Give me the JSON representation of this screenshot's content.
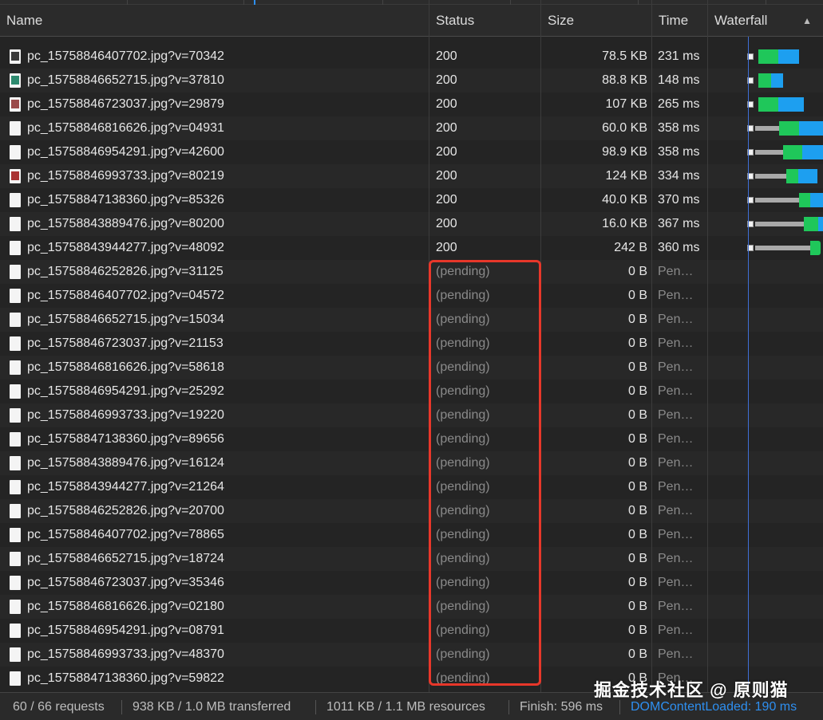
{
  "columns": {
    "name": "Name",
    "status": "Status",
    "size": "Size",
    "time": "Time",
    "waterfall": "Waterfall"
  },
  "rows": [
    {
      "name": "pc_15758846407702.jpg?v=70342",
      "status": "200",
      "size": "78.5 KB",
      "time": "231 ms",
      "icon": "image-file-icon"
    },
    {
      "name": "pc_15758846652715.jpg?v=37810",
      "status": "200",
      "size": "88.8 KB",
      "time": "148 ms",
      "icon": "image-file-icon"
    },
    {
      "name": "pc_15758846723037.jpg?v=29879",
      "status": "200",
      "size": "107 KB",
      "time": "265 ms",
      "icon": "image-file-icon"
    },
    {
      "name": "pc_15758846816626.jpg?v=04931",
      "status": "200",
      "size": "60.0 KB",
      "time": "358 ms",
      "icon": "file-icon"
    },
    {
      "name": "pc_15758846954291.jpg?v=42600",
      "status": "200",
      "size": "98.9 KB",
      "time": "358 ms",
      "icon": "file-icon"
    },
    {
      "name": "pc_15758846993733.jpg?v=80219",
      "status": "200",
      "size": "124 KB",
      "time": "334 ms",
      "icon": "image-file-icon"
    },
    {
      "name": "pc_15758847138360.jpg?v=85326",
      "status": "200",
      "size": "40.0 KB",
      "time": "370 ms",
      "icon": "file-icon"
    },
    {
      "name": "pc_15758843889476.jpg?v=80200",
      "status": "200",
      "size": "16.0 KB",
      "time": "367 ms",
      "icon": "file-icon"
    },
    {
      "name": "pc_15758843944277.jpg?v=48092",
      "status": "200",
      "size": "242 B",
      "time": "360 ms",
      "icon": "file-icon"
    },
    {
      "name": "pc_15758846252826.jpg?v=31125",
      "status": "(pending)",
      "size": "0 B",
      "time": "Pen…",
      "icon": "file-icon"
    },
    {
      "name": "pc_15758846407702.jpg?v=04572",
      "status": "(pending)",
      "size": "0 B",
      "time": "Pen…",
      "icon": "file-icon"
    },
    {
      "name": "pc_15758846652715.jpg?v=15034",
      "status": "(pending)",
      "size": "0 B",
      "time": "Pen…",
      "icon": "file-icon"
    },
    {
      "name": "pc_15758846723037.jpg?v=21153",
      "status": "(pending)",
      "size": "0 B",
      "time": "Pen…",
      "icon": "file-icon"
    },
    {
      "name": "pc_15758846816626.jpg?v=58618",
      "status": "(pending)",
      "size": "0 B",
      "time": "Pen…",
      "icon": "file-icon"
    },
    {
      "name": "pc_15758846954291.jpg?v=25292",
      "status": "(pending)",
      "size": "0 B",
      "time": "Pen…",
      "icon": "file-icon"
    },
    {
      "name": "pc_15758846993733.jpg?v=19220",
      "status": "(pending)",
      "size": "0 B",
      "time": "Pen…",
      "icon": "file-icon"
    },
    {
      "name": "pc_15758847138360.jpg?v=89656",
      "status": "(pending)",
      "size": "0 B",
      "time": "Pen…",
      "icon": "file-icon"
    },
    {
      "name": "pc_15758843889476.jpg?v=16124",
      "status": "(pending)",
      "size": "0 B",
      "time": "Pen…",
      "icon": "file-icon"
    },
    {
      "name": "pc_15758843944277.jpg?v=21264",
      "status": "(pending)",
      "size": "0 B",
      "time": "Pen…",
      "icon": "file-icon"
    },
    {
      "name": "pc_15758846252826.jpg?v=20700",
      "status": "(pending)",
      "size": "0 B",
      "time": "Pen…",
      "icon": "file-icon"
    },
    {
      "name": "pc_15758846407702.jpg?v=78865",
      "status": "(pending)",
      "size": "0 B",
      "time": "Pen…",
      "icon": "file-icon"
    },
    {
      "name": "pc_15758846652715.jpg?v=18724",
      "status": "(pending)",
      "size": "0 B",
      "time": "Pen…",
      "icon": "file-icon"
    },
    {
      "name": "pc_15758846723037.jpg?v=35346",
      "status": "(pending)",
      "size": "0 B",
      "time": "Pen…",
      "icon": "file-icon"
    },
    {
      "name": "pc_15758846816626.jpg?v=02180",
      "status": "(pending)",
      "size": "0 B",
      "time": "Pen…",
      "icon": "file-icon"
    },
    {
      "name": "pc_15758846954291.jpg?v=08791",
      "status": "(pending)",
      "size": "0 B",
      "time": "Pen…",
      "icon": "file-icon"
    },
    {
      "name": "pc_15758846993733.jpg?v=48370",
      "status": "(pending)",
      "size": "0 B",
      "time": "Pen…",
      "icon": "file-icon"
    },
    {
      "name": "pc_15758847138360.jpg?v=59822",
      "status": "(pending)",
      "size": "0 B",
      "time": "Pen…",
      "icon": "file-icon"
    }
  ],
  "footer": {
    "requests": "60 / 66 requests",
    "transferred": "938 KB / 1.0 MB transferred",
    "resources": "1011 KB / 1.1 MB resources",
    "finish": "Finish: 596 ms",
    "dom_content_loaded": "DOMContentLoaded: 190 ms"
  },
  "watermark": "掘金技术社区 @ 原则猫",
  "colors": {
    "background": "#242424",
    "waiting_green": "#1fc75a",
    "download_blue": "#1d9ff0",
    "dcl_line": "#3f6fd8",
    "highlight": "#e8372a"
  }
}
